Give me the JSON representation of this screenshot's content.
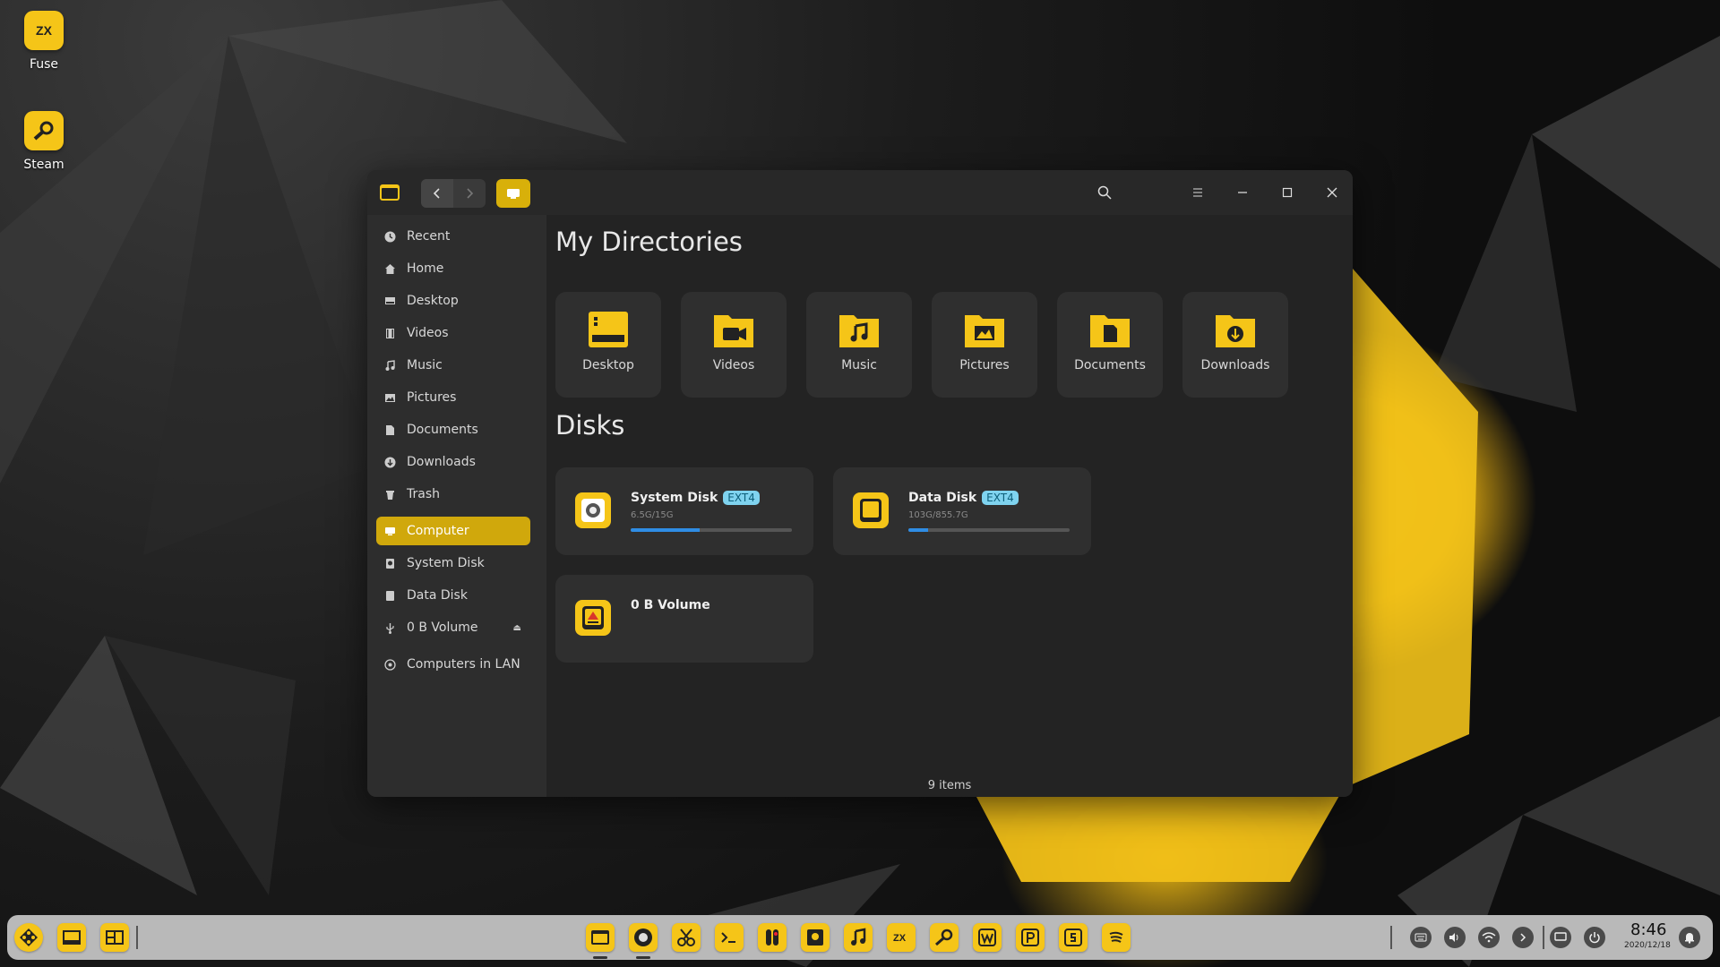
{
  "desktop": {
    "icons": [
      {
        "label": "Fuse",
        "glyph": "ZX"
      },
      {
        "label": "Steam",
        "glyph": "steam-icon"
      }
    ]
  },
  "window": {
    "sidebar": {
      "places": [
        {
          "label": "Recent",
          "icon": "clock-icon"
        },
        {
          "label": "Home",
          "icon": "home-icon"
        },
        {
          "label": "Desktop",
          "icon": "desktop-icon"
        },
        {
          "label": "Videos",
          "icon": "film-icon"
        },
        {
          "label": "Music",
          "icon": "music-note-icon"
        },
        {
          "label": "Pictures",
          "icon": "image-icon"
        },
        {
          "label": "Documents",
          "icon": "document-icon"
        },
        {
          "label": "Downloads",
          "icon": "download-icon"
        },
        {
          "label": "Trash",
          "icon": "trash-icon"
        }
      ],
      "devices": [
        {
          "label": "Computer",
          "icon": "computer-icon",
          "active": true
        },
        {
          "label": "System Disk",
          "icon": "disk-icon"
        },
        {
          "label": "Data Disk",
          "icon": "disk-icon"
        },
        {
          "label": "0 B Volume",
          "icon": "usb-icon",
          "eject": "⏏"
        }
      ],
      "network": {
        "label": "Computers in LAN",
        "icon": "network-icon"
      }
    },
    "content": {
      "directories_title": "My Directories",
      "directories": [
        {
          "label": "Desktop",
          "icon": "desktop-folder-icon"
        },
        {
          "label": "Videos",
          "icon": "videos-folder-icon"
        },
        {
          "label": "Music",
          "icon": "music-folder-icon"
        },
        {
          "label": "Pictures",
          "icon": "pictures-folder-icon"
        },
        {
          "label": "Documents",
          "icon": "documents-folder-icon"
        },
        {
          "label": "Downloads",
          "icon": "downloads-folder-icon"
        }
      ],
      "disks_title": "Disks",
      "disks": [
        {
          "name": "System Disk",
          "fs": "EXT4",
          "usage": "6.5G/15G",
          "fill_percent": 43
        },
        {
          "name": "Data Disk",
          "fs": "EXT4",
          "usage": "103G/855.7G",
          "fill_percent": 12
        },
        {
          "name": "0 B Volume"
        }
      ],
      "status": "9 items"
    }
  },
  "taskbar": {
    "clock": {
      "time": "8:46",
      "date": "2020/12/18"
    },
    "apps": [
      "file-manager-icon",
      "browser-icon",
      "screenshot-icon",
      "terminal-icon",
      "control-icon",
      "album-icon",
      "music-icon",
      "zx-icon",
      "steam-icon",
      "writer-icon",
      "presentation-icon",
      "spreadsheet-icon",
      "spotify-icon"
    ]
  },
  "colors": {
    "accent": "#f5c518",
    "active": "#d0a80c",
    "badge": "#7fd3ef",
    "progress": "#2f8de4"
  }
}
